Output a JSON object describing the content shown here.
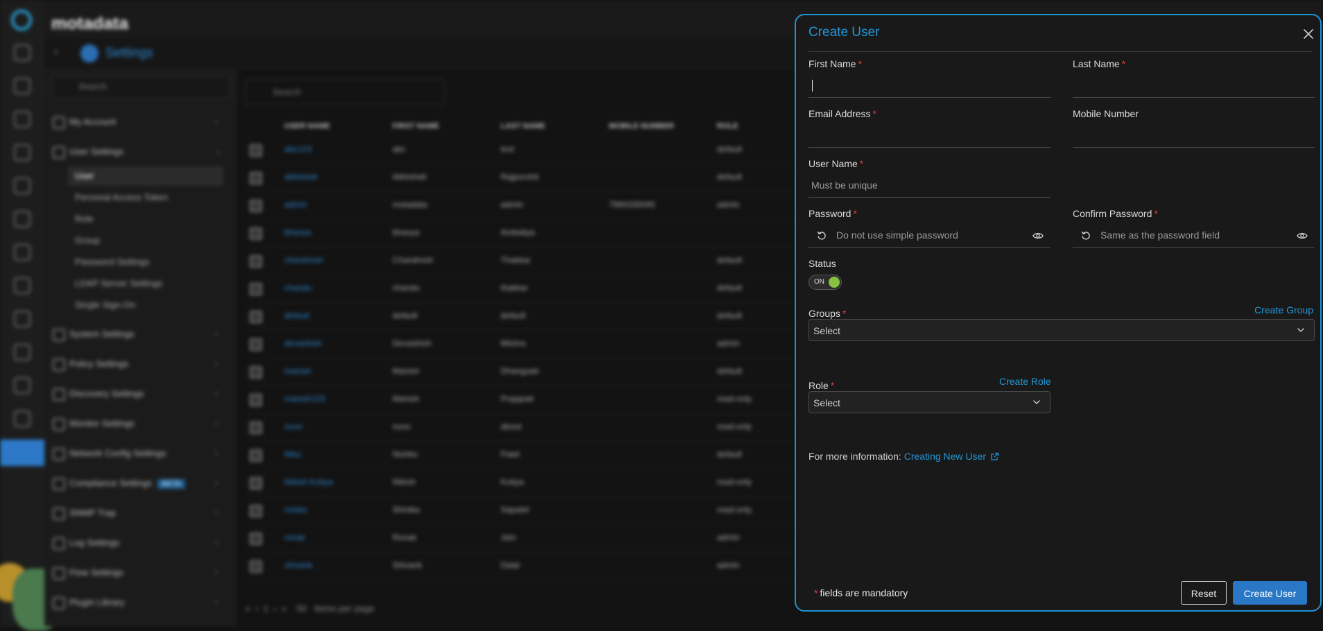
{
  "background": {
    "logo": "motadata",
    "page_title": "Settings",
    "sidebar_search_placeholder": "Search",
    "sidebar": {
      "sections": [
        {
          "label": "My Account"
        },
        {
          "label": "User Settings"
        },
        {
          "label": "System Settings"
        },
        {
          "label": "Policy Settings"
        },
        {
          "label": "Discovery Settings"
        },
        {
          "label": "Monitor Settings"
        },
        {
          "label": "Network Config Settings"
        },
        {
          "label": "Compliance Settings",
          "badge": "BETA"
        },
        {
          "label": "SNMP Trap"
        },
        {
          "label": "Log Settings"
        },
        {
          "label": "Flow Settings"
        },
        {
          "label": "Plugin Library"
        }
      ],
      "user_settings_items": [
        "User",
        "Personal Access Token",
        "Role",
        "Group",
        "Password Settings",
        "LDAP Server Settings",
        "Single Sign-On"
      ]
    },
    "table_search_placeholder": "Search",
    "table": {
      "columns": [
        "USER NAME",
        "FIRST NAME",
        "LAST NAME",
        "MOBILE NUMBER",
        "ROLE"
      ],
      "rows": [
        [
          "abc123",
          "abc",
          "test",
          "",
          "default"
        ],
        [
          "abhishek",
          "Abhishek",
          "Rajpurohit",
          "",
          "default"
        ],
        [
          "admin",
          "motadata",
          "admin",
          "7984330045",
          "admin"
        ],
        [
          "bhavya",
          "bhavya",
          "Ambaliya",
          "",
          ""
        ],
        [
          "chandresh",
          "Chandresh",
          "Thakkar",
          "",
          "default"
        ],
        [
          "chandu",
          "chandu",
          "thakkar",
          "",
          "default"
        ],
        [
          "default",
          "default",
          "default",
          "",
          "default"
        ],
        [
          "devashish",
          "Devashish",
          "Mishra",
          "",
          "admin"
        ],
        [
          "manish",
          "Manish",
          "Dhangude",
          "",
          "default"
        ],
        [
          "manish123",
          "Manish",
          "Prajapati",
          "",
          "read-only"
        ],
        [
          "nuvo",
          "nuvo",
          "about",
          "",
          "read-only"
        ],
        [
          "Niku",
          "Nishko",
          "Patel",
          "",
          "default"
        ],
        [
          "Nilesh Kotiya",
          "Nilesh",
          "Kotiya",
          "",
          "read-only"
        ],
        [
          "ronika",
          "Shinika",
          "Sapatel",
          "",
          "read-only"
        ],
        [
          "ronak",
          "Ronak",
          "Jain",
          "",
          "admin"
        ],
        [
          "shivank",
          "Shivank",
          "Dalal",
          "",
          "admin"
        ]
      ]
    },
    "pager": {
      "page": "1",
      "per_page": "50",
      "per_page_label": "Items per page"
    }
  },
  "panel": {
    "title": "Create User",
    "first_name": {
      "label": "First Name",
      "value": ""
    },
    "last_name": {
      "label": "Last Name",
      "value": ""
    },
    "email": {
      "label": "Email Address",
      "value": ""
    },
    "mobile": {
      "label": "Mobile Number",
      "value": ""
    },
    "username": {
      "label": "User Name",
      "placeholder": "Must be unique"
    },
    "password": {
      "label": "Password",
      "placeholder": "Do not use simple password"
    },
    "confirm_password": {
      "label": "Confirm Password",
      "placeholder": "Same as the password field"
    },
    "status": {
      "label": "Status",
      "toggle_text": "ON",
      "on": true
    },
    "groups": {
      "label": "Groups",
      "value": "Select",
      "create_link": "Create Group"
    },
    "role": {
      "label": "Role",
      "value": "Select",
      "create_link": "Create Role"
    },
    "info": {
      "prefix": "For more information:",
      "link": "Creating New User"
    },
    "mandatory_star": "*",
    "mandatory_text": "fields are mandatory",
    "reset_label": "Reset",
    "create_label": "Create User"
  },
  "colors": {
    "accent": "#2396d7",
    "primary_button": "#2a78c5",
    "required": "#e0413d",
    "toggle_on": "#87c13d"
  }
}
